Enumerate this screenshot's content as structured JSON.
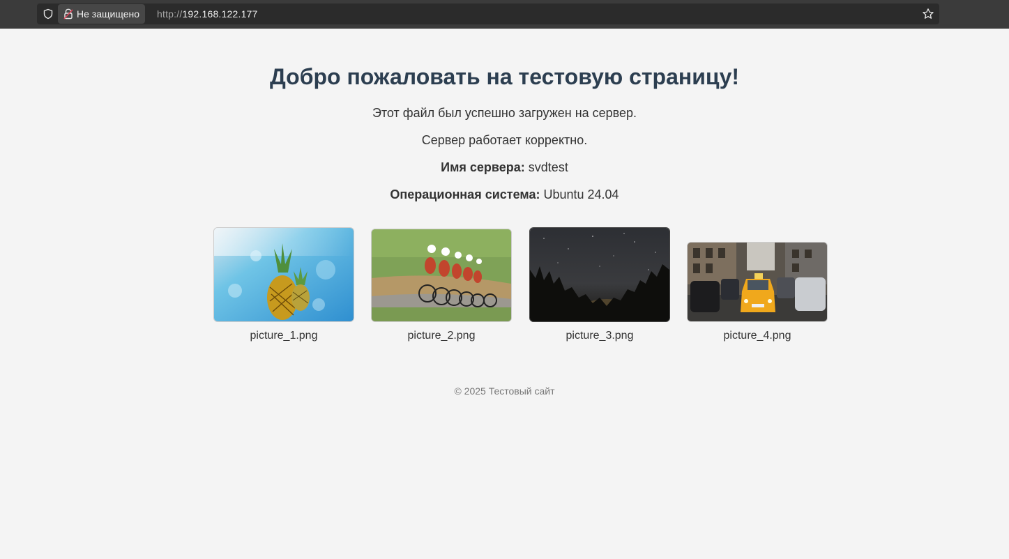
{
  "browser": {
    "security_label": "Не защищено",
    "url_scheme": "http://",
    "url_host": "192.168.122.177"
  },
  "page": {
    "heading": "Добро пожаловать на тестовую страницу!",
    "line1": "Этот файл был успешно загружен на сервер.",
    "line2": "Сервер работает корректно.",
    "server_name_label": "Имя сервера:",
    "server_name_value": "svdtest",
    "os_label": "Операционная система:",
    "os_value": "Ubuntu 24.04"
  },
  "gallery": [
    {
      "caption": "picture_1.png"
    },
    {
      "caption": "picture_2.png"
    },
    {
      "caption": "picture_3.png"
    },
    {
      "caption": "picture_4.png"
    }
  ],
  "footer": {
    "text": "© 2025 Тестовый сайт"
  }
}
